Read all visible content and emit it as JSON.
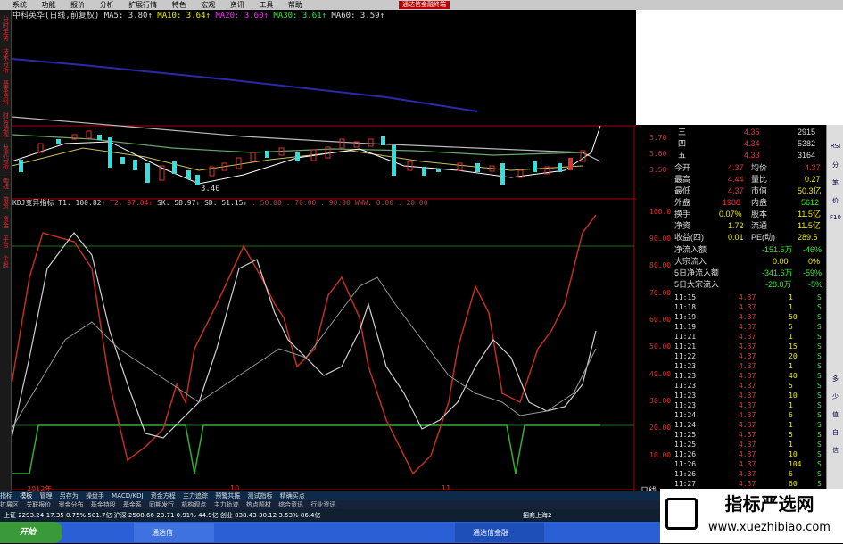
{
  "menu": [
    "系统",
    "功能",
    "报价",
    "分析",
    "扩展行情",
    "特色",
    "宏观",
    "资讯",
    "工具",
    "帮助"
  ],
  "promo": "通达信金融终端",
  "left_tabs": [
    "分时走势",
    "技术分析",
    "基本资料",
    "财务透视",
    "龙虎分析",
    "画线",
    "游资",
    "资金",
    "平台",
    "个股"
  ],
  "ma_header": {
    "stock": "中科英华(日线,前复权)",
    "ma5": "MA5: 3.80↑",
    "ma10": "MA10: 3.64↑",
    "ma20": "MA20: 3.60↑",
    "ma30": "MA30: 3.61↑",
    "ma60": "MA60: 3.59↑"
  },
  "kdj_header": {
    "name": "KDJ变异指标",
    "t1": "T1: 100.82↑",
    "t2": "T2: 97.04↑",
    "sk": "SK: 58.97↑",
    "sd": "SD: 51.15↑",
    "rest": ": 50.00 : 70.00 : 90.00 WWW: 0.00 : 20.00"
  },
  "price_low_label": "3.40",
  "axis": [
    "3.70",
    "3.60",
    "3.50",
    "100.0",
    "90.00",
    "80.00",
    "70.00",
    "60.00",
    "50.00",
    "40.00",
    "30.00",
    "20.00",
    "10.00"
  ],
  "x_labels": [
    "2012年",
    "10",
    "11",
    "日线"
  ],
  "quote": {
    "levels": [
      [
        "三",
        "4.35",
        "2915"
      ],
      [
        "四",
        "4.34",
        "5382"
      ],
      [
        "五",
        "4.33",
        "3164"
      ]
    ],
    "stats": [
      [
        "今开",
        "4.37",
        "均价",
        "4.37"
      ],
      [
        "最高",
        "4.44",
        "量比",
        "0.27"
      ],
      [
        "最低",
        "4.37",
        "市值",
        "50.3亿"
      ],
      [
        "外盘",
        "1988",
        "内盘",
        "5612"
      ],
      [
        "换手",
        "0.07%",
        "股本",
        "11.5亿"
      ],
      [
        "净资",
        "1.72",
        "流通",
        "11.5亿"
      ],
      [
        "收益(四)",
        "0.01",
        "PE(动)",
        "289.5"
      ]
    ],
    "flows": [
      [
        "净流入额",
        "-151.5万",
        "-46%"
      ],
      [
        "大宗流入",
        "0.00",
        "0%"
      ],
      [
        "5日净流入额",
        "-341.6万",
        "-59%"
      ],
      [
        "5日大宗流入",
        "-28.0万",
        "-5%"
      ]
    ],
    "ticks": [
      [
        "11:15",
        "4.37",
        "1",
        "S"
      ],
      [
        "11:18",
        "4.37",
        "1",
        "S"
      ],
      [
        "11:19",
        "4.37",
        "50",
        "S"
      ],
      [
        "11:19",
        "4.37",
        "5",
        "S"
      ],
      [
        "11:21",
        "4.37",
        "1",
        "S"
      ],
      [
        "11:21",
        "4.37",
        "15",
        "S"
      ],
      [
        "11:22",
        "4.37",
        "20",
        "S"
      ],
      [
        "11:23",
        "4.37",
        "1",
        "S"
      ],
      [
        "11:23",
        "4.37",
        "40",
        "S"
      ],
      [
        "11:23",
        "4.37",
        "5",
        "S"
      ],
      [
        "11:23",
        "4.37",
        "10",
        "S"
      ],
      [
        "11:23",
        "4.37",
        "1",
        "S"
      ],
      [
        "11:24",
        "4.37",
        "6",
        "S"
      ],
      [
        "11:24",
        "4.37",
        "1",
        "S"
      ],
      [
        "11:25",
        "4.37",
        "5",
        "S"
      ],
      [
        "11:25",
        "4.37",
        "1",
        "S"
      ],
      [
        "11:26",
        "4.37",
        "10",
        "S"
      ],
      [
        "11:26",
        "4.37",
        "104",
        "S"
      ],
      [
        "11:26",
        "4.37",
        "6",
        "S"
      ],
      [
        "11:27",
        "4.37",
        "60",
        "S"
      ]
    ]
  },
  "right_side": [
    "RSI",
    "分",
    "笔",
    "价",
    "F10",
    "多",
    "少",
    "值",
    "自",
    "信"
  ],
  "tabbar": [
    "指标",
    "模板",
    "管理",
    "另存为",
    "操盘手",
    "MACD/KDJ",
    "资金方程",
    "主力追踪",
    "预警共振",
    "测试指标",
    "精确买点"
  ],
  "tabbar2": [
    "扩展区",
    "关联报价",
    "资金分布",
    "基金持股",
    "基金系",
    "同期发行",
    "机构观点",
    "主力轨迹",
    "热点题材",
    "综合资讯",
    "行业资讯"
  ],
  "status": "上证 2293.24-17.35 0.75% 501.7亿 沪深 2508.66-23.71 0.91% 44.9亿 创业 838.43-30.12 3.53% 86.4亿",
  "status_right": "招商上海2",
  "taskbar": {
    "start": "开始",
    "app1": "通达信",
    "app2": "通达信金融"
  },
  "watermark": {
    "title": "指标严选网",
    "url": "www.xuezhibiao.com"
  },
  "colors": {
    "red": "#e03030",
    "green": "#40c040",
    "cyan": "#30e0e0"
  }
}
